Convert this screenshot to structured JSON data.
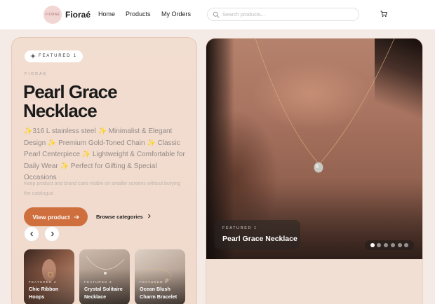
{
  "header": {
    "logo_text": "FIORAÉ",
    "brand": "Fioraé",
    "nav": [
      "Home",
      "Products",
      "My Orders"
    ],
    "search_placeholder": "Search products..."
  },
  "featured": {
    "badge": "FEATURED 1",
    "eyebrow": "FIORAÉ",
    "title": "Pearl Grace Necklace",
    "description": "✨316 L stainless steel ✨ Minimalist & Elegant Design ✨ Premium Gold-Toned Chain ✨ Classic Pearl Centerpiece ✨ Lightweight & Comfortable for Daily Wear ✨ Perfect for Gifting & Special Occasions",
    "hint": "Keep product and brand cues visible on smaller screens without burying the catalogue.",
    "primary_button": "View product",
    "secondary_link": "Browse categories"
  },
  "thumbnails": [
    {
      "eyebrow": "FEATURED 2",
      "name": "Chic Ribbon Hoops"
    },
    {
      "eyebrow": "FEATURED 3",
      "name": "Crystal Solitaire Necklace"
    },
    {
      "eyebrow": "FEATURED 4",
      "name": "Ocean Blush Charm Bracelet"
    }
  ],
  "hero": {
    "eyebrow": "FEATURED 1",
    "title": "Pearl Grace Necklace",
    "slide_count": 6,
    "active_slide": 1
  },
  "colors": {
    "accent": "#cf6f3d",
    "page_bg": "#f5ebe6",
    "card_bg": "#f2ddd1"
  }
}
